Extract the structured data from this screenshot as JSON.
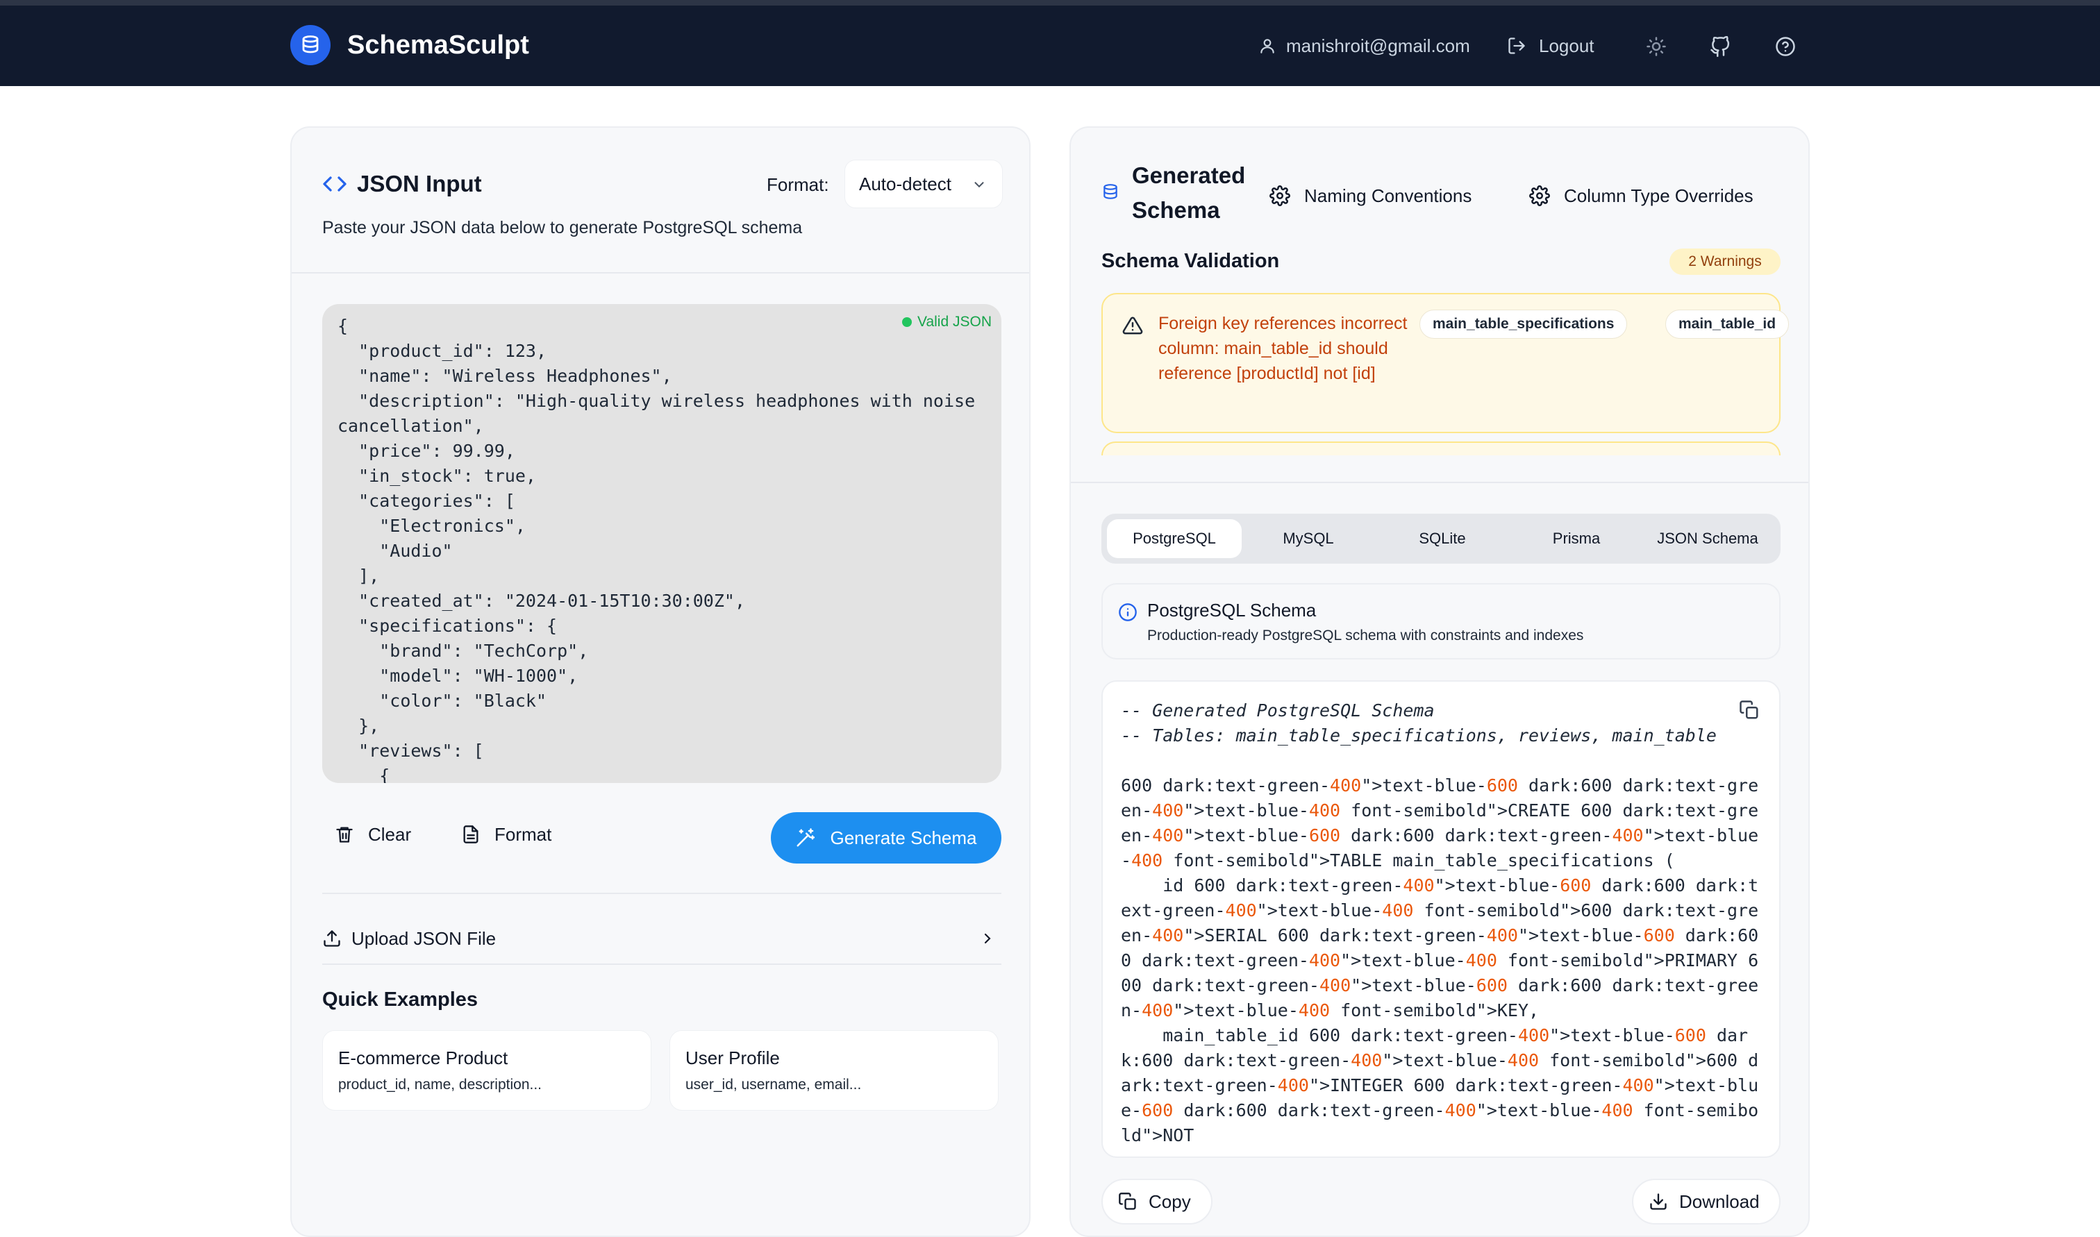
{
  "app": {
    "name": "SchemaSculpt",
    "user_email": "manishroit@gmail.com",
    "logout_label": "Logout"
  },
  "json_input": {
    "title": "JSON Input",
    "format_label": "Format:",
    "format_value": "Auto-detect",
    "description": "Paste your JSON data below to generate PostgreSQL schema",
    "valid_status": "Valid JSON",
    "content": "{\n  \"product_id\": 123,\n  \"name\": \"Wireless Headphones\",\n  \"description\": \"High-quality wireless headphones with noise cancellation\",\n  \"price\": 99.99,\n  \"in_stock\": true,\n  \"categories\": [\n    \"Electronics\",\n    \"Audio\"\n  ],\n  \"created_at\": \"2024-01-15T10:30:00Z\",\n  \"specifications\": {\n    \"brand\": \"TechCorp\",\n    \"model\": \"WH-1000\",\n    \"color\": \"Black\"\n  },\n  \"reviews\": [\n    {",
    "clear_label": "Clear",
    "format_button_label": "Format",
    "generate_label": "Generate Schema",
    "upload_label": "Upload JSON File",
    "quick_examples_title": "Quick Examples",
    "examples": [
      {
        "title": "E-commerce Product",
        "fields": "product_id, name, description..."
      },
      {
        "title": "User Profile",
        "fields": "user_id, username, email..."
      }
    ]
  },
  "schema": {
    "title": "Generated Schema",
    "naming_label": "Naming Conventions",
    "overrides_label": "Column Type Overrides",
    "validation_title": "Schema Validation",
    "warnings_badge": "2 Warnings",
    "warning_message": "Foreign key references incorrect column: main_table_id should reference [productId] not [id]",
    "warning_tags": [
      "main_table_specifications",
      "main_table_id"
    ],
    "tabs": [
      "PostgreSQL",
      "MySQL",
      "SQLite",
      "Prisma",
      "JSON Schema"
    ],
    "active_tab": "PostgreSQL",
    "info_title": "PostgreSQL Schema",
    "info_desc": "Production-ready PostgreSQL schema with constraints and indexes",
    "code_comment_1": "-- Generated PostgreSQL Schema",
    "code_comment_2": "-- Tables: main_table_specifications, reviews, main_table",
    "code_body": "600 dark:text-green-400\">text-blue-600 dark:600 dark:text-green-400\">text-blue-400 font-semibold\">CREATE 600 dark:text-green-400\">text-blue-600 dark:600 dark:text-green-400\">text-blue-400 font-semibold\">TABLE main_table_specifications (\n    id 600 dark:text-green-400\">text-blue-600 dark:600 dark:text-green-400\">text-blue-400 font-semibold\">600 dark:text-green-400\">SERIAL 600 dark:text-green-400\">text-blue-600 dark:600 dark:text-green-400\">text-blue-400 font-semibold\">PRIMARY 600 dark:text-green-400\">text-blue-600 dark:600 dark:text-green-400\">text-blue-400 font-semibold\">KEY,\n    main_table_id 600 dark:text-green-400\">text-blue-600 dark:600 dark:text-green-400\">text-blue-400 font-semibold\">600 dark:text-green-400\">INTEGER 600 dark:text-green-400\">text-blue-600 dark:600 dark:text-green-400\">text-blue-400 font-semibold\">NOT",
    "copy_label": "Copy",
    "download_label": "Download"
  },
  "colors": {
    "nav_bg": "#111a2e",
    "accent": "#1d8ff0",
    "warning_text": "#c2410c",
    "valid_green": "#16a34a"
  }
}
